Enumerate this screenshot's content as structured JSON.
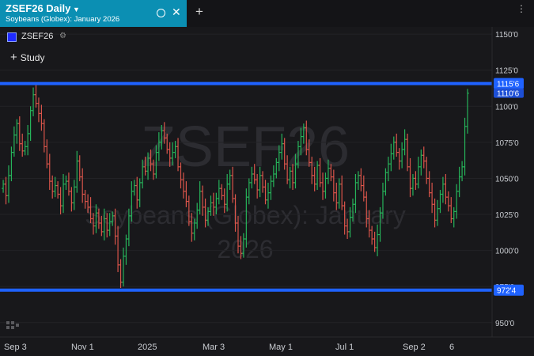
{
  "tab": {
    "title": "ZSEF26 Daily",
    "subtitle": "Soybeans (Globex): January 2026"
  },
  "symbol": {
    "label": "ZSEF26"
  },
  "study": {
    "label": "Study"
  },
  "watermark": {
    "symbol": "ZSEF26",
    "description_line1": "Soybeans (Globex): January",
    "description_line2": "2026"
  },
  "colors": {
    "up": "#26b35a",
    "down": "#d8544a",
    "level_line": "#1f62ff",
    "accent_tab": "#0b8fb3",
    "background": "#18181b"
  },
  "chart_data": {
    "type": "candlestick",
    "y_axis": {
      "min": 940,
      "max": 1155,
      "ticks": [
        1150,
        1125,
        1100,
        1075,
        1050,
        1025,
        1000,
        975,
        950
      ],
      "tick_labels": [
        "1150'0",
        "1125'0",
        "1100'0",
        "1075'0",
        "1050'0",
        "1025'0",
        "1000'0",
        "975'0",
        "950'0"
      ]
    },
    "x_axis": {
      "tick_labels": [
        "Sep 3",
        "Nov 1",
        "2025",
        "Mar 3",
        "May 1",
        "Jul 1",
        "Sep 2",
        "6"
      ]
    },
    "horizontal_levels": [
      {
        "value": 1115.75,
        "label": "1115'6"
      },
      {
        "value": 972.5,
        "label": "972'4"
      }
    ],
    "last_price": {
      "value": 1110.75,
      "label": "1110'6"
    },
    "bar_closes": [
      1046,
      1038,
      1052,
      1068,
      1080,
      1088,
      1074,
      1069,
      1072,
      1081,
      1097,
      1108,
      1102,
      1095,
      1088,
      1072,
      1060,
      1048,
      1041,
      1045,
      1039,
      1031,
      1046,
      1048,
      1041,
      1033,
      1044,
      1062,
      1051,
      1039,
      1034,
      1030,
      1022,
      1017,
      1026,
      1019,
      1013,
      1022,
      1014,
      1020,
      1024,
      1010,
      990,
      978,
      996,
      1008,
      1024,
      1041,
      1045,
      1035,
      1047,
      1058,
      1055,
      1064,
      1060,
      1053,
      1068,
      1075,
      1083,
      1078,
      1070,
      1064,
      1068,
      1072,
      1058,
      1049,
      1041,
      1034,
      1020,
      1012,
      1019,
      1028,
      1041,
      1030,
      1021,
      1027,
      1033,
      1030,
      1036,
      1043,
      1038,
      1032,
      1046,
      1052,
      1036,
      1019,
      1003,
      998,
      1008,
      1037,
      1047,
      1053,
      1049,
      1042,
      1052,
      1044,
      1035,
      1040,
      1048,
      1053,
      1061,
      1068,
      1074,
      1060,
      1049,
      1055,
      1047,
      1060,
      1072,
      1079,
      1085,
      1070,
      1061,
      1052,
      1046,
      1059,
      1047,
      1041,
      1050,
      1057,
      1051,
      1040,
      1033,
      1046,
      1031,
      1017,
      1013,
      1023,
      1032,
      1047,
      1052,
      1045,
      1037,
      1022,
      1014,
      1008,
      1002,
      1011,
      1026,
      1041,
      1054,
      1060,
      1067,
      1075,
      1068,
      1062,
      1070,
      1077,
      1058,
      1043,
      1050,
      1046,
      1058,
      1066,
      1062,
      1050,
      1040,
      1032,
      1021,
      1029,
      1039,
      1046,
      1037,
      1031,
      1022,
      1027,
      1041,
      1051,
      1058,
      1086,
      1109
    ]
  }
}
